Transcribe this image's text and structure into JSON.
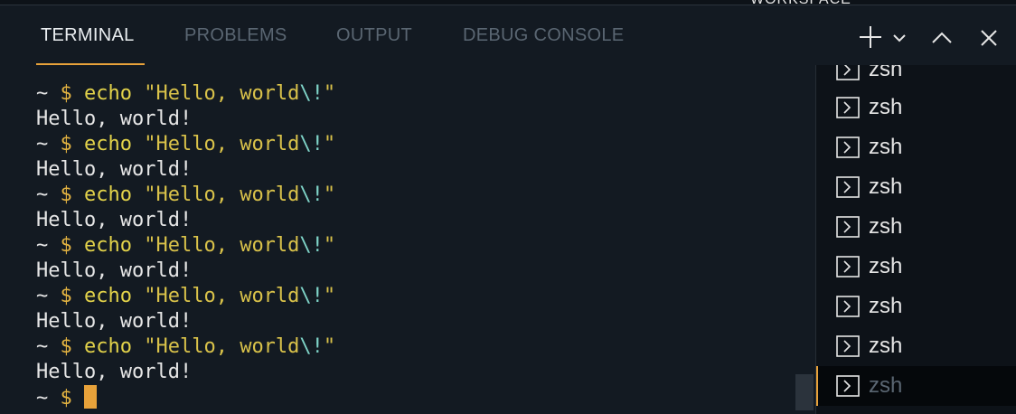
{
  "top_strip": {
    "partial_text": "WORKSPACE"
  },
  "tabs": [
    {
      "label": "TERMINAL",
      "active": true
    },
    {
      "label": "PROBLEMS",
      "active": false
    },
    {
      "label": "OUTPUT",
      "active": false
    },
    {
      "label": "DEBUG CONSOLE",
      "active": false
    }
  ],
  "actions": [
    {
      "name": "new-terminal",
      "icon": "plus-icon"
    },
    {
      "name": "terminal-dropdown",
      "icon": "chevron-down-icon"
    },
    {
      "name": "maximize-panel",
      "icon": "chevron-up-icon"
    },
    {
      "name": "close-panel",
      "icon": "close-icon"
    }
  ],
  "terminal": {
    "lines": [
      {
        "tilde": "~",
        "dollar": "$",
        "cmd": "echo",
        "str_a": "\"Hello, world",
        "esc": "\\!",
        "str_b": "\""
      },
      {
        "output": "Hello, world!"
      },
      {
        "tilde": "~",
        "dollar": "$",
        "cmd": "echo",
        "str_a": "\"Hello, world",
        "esc": "\\!",
        "str_b": "\""
      },
      {
        "output": "Hello, world!"
      },
      {
        "tilde": "~",
        "dollar": "$",
        "cmd": "echo",
        "str_a": "\"Hello, world",
        "esc": "\\!",
        "str_b": "\""
      },
      {
        "output": "Hello, world!"
      },
      {
        "tilde": "~",
        "dollar": "$",
        "cmd": "echo",
        "str_a": "\"Hello, world",
        "esc": "\\!",
        "str_b": "\""
      },
      {
        "output": "Hello, world!"
      },
      {
        "tilde": "~",
        "dollar": "$",
        "cmd": "echo",
        "str_a": "\"Hello, world",
        "esc": "\\!",
        "str_b": "\""
      },
      {
        "output": "Hello, world!"
      },
      {
        "tilde": "~",
        "dollar": "$",
        "cmd": "echo",
        "str_a": "\"Hello, world",
        "esc": "\\!",
        "str_b": "\""
      },
      {
        "output": "Hello, world!"
      }
    ],
    "current_prompt": {
      "tilde": "~",
      "dollar": "$"
    }
  },
  "terminal_list": {
    "icon": "terminal-icon",
    "items": [
      {
        "label": "zsh"
      },
      {
        "label": "zsh"
      },
      {
        "label": "zsh"
      },
      {
        "label": "zsh"
      },
      {
        "label": "zsh"
      },
      {
        "label": "zsh"
      },
      {
        "label": "zsh"
      },
      {
        "label": "zsh"
      },
      {
        "label": "zsh",
        "selected": true
      }
    ]
  },
  "colors": {
    "background": "#131a22",
    "accent": "#e8a23a",
    "string": "#d9c24a",
    "escape": "#7fd4c8",
    "text": "#e6e6e6",
    "inactive_tab": "#5a6672"
  }
}
